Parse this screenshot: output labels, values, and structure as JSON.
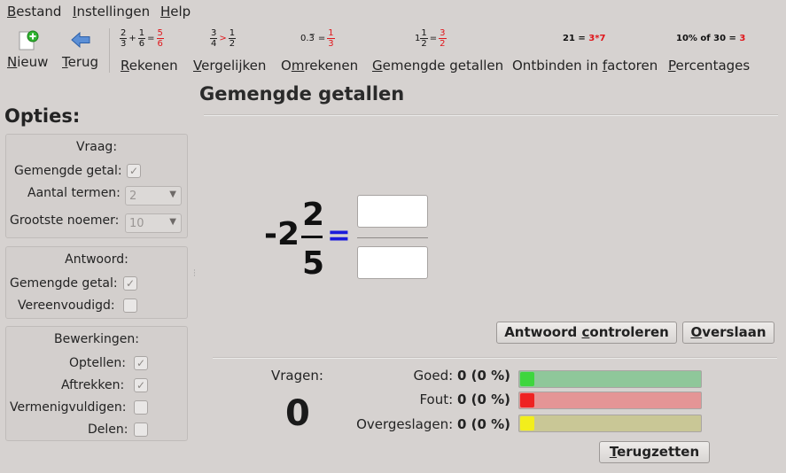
{
  "menu": {
    "items": [
      {
        "first": "B",
        "rest": "estand"
      },
      {
        "first": "I",
        "rest": "nstellingen"
      },
      {
        "first": "H",
        "rest": "elp"
      }
    ]
  },
  "toolbar": {
    "new": {
      "first": "N",
      "rest": "ieuw",
      "icon": "new-document-icon"
    },
    "back": {
      "first": "T",
      "rest": "erug",
      "icon": "arrow-left-icon"
    },
    "modes": [
      {
        "first": "R",
        "rest": "ekenen"
      },
      {
        "first": "V",
        "rest": "ergelijken"
      },
      {
        "pre": "O",
        "u": "m",
        "rest": "rekenen"
      },
      {
        "pre": "",
        "u": "G",
        "rest": "emengde getallen"
      },
      {
        "pre": "Ontbinden in ",
        "u": "f",
        "rest": "actoren"
      },
      {
        "pre": "",
        "u": "P",
        "rest": "ercentages"
      }
    ],
    "previews": {
      "rekenen": {
        "a_n": "2",
        "a_d": "3",
        "op1": "+",
        "b_n": "1",
        "b_d": "6",
        "eq": "=",
        "r_n": "5",
        "r_d": "6"
      },
      "vergelijken": {
        "a_n": "3",
        "a_d": "4",
        "op": ">",
        "b_n": "1",
        "b_d": "2"
      },
      "omrekenen": {
        "left": "0.3̅",
        "eq": "=",
        "r_n": "1",
        "r_d": "3"
      },
      "gemengd": {
        "whole": "1",
        "a_n": "1",
        "a_d": "2",
        "eq": "=",
        "r_n": "3",
        "r_d": "2"
      },
      "factoren": {
        "left": "21 =",
        "right": "3*7"
      },
      "percentages": {
        "left": "10% of 30 =",
        "right": "3"
      }
    }
  },
  "page_title": "Gemengde getallen",
  "sidebar": {
    "title": "Opties:",
    "vraag": {
      "title": "Vraag:",
      "gemengd_label": "Gemengde getal:",
      "gemengd_checked": "✓",
      "termen_label": "Aantal termen:",
      "termen_value": "2",
      "noemer_label": "Grootste noemer:",
      "noemer_value": "10"
    },
    "antwoord": {
      "title": "Antwoord:",
      "gemengd_label": "Gemengde getal:",
      "gemengd_checked": "✓",
      "vereenvoudigd_label": "Vereenvoudigd:",
      "vereenvoudigd_checked": ""
    },
    "bewerkingen": {
      "title": "Bewerkingen:",
      "items": [
        {
          "label": "Optellen:",
          "checked": "✓"
        },
        {
          "label": "Aftrekken:",
          "checked": "✓"
        },
        {
          "label": "Vermenigvuldigen:",
          "checked": ""
        },
        {
          "label": "Delen:",
          "checked": ""
        }
      ]
    }
  },
  "exercise": {
    "whole": "-2",
    "numerator": "2",
    "denominator": "5",
    "equals": "=",
    "answer_numerator": "",
    "answer_denominator": ""
  },
  "buttons": {
    "check": {
      "pre": "Antwoord ",
      "u": "c",
      "rest": "ontroleren"
    },
    "skip": {
      "pre": "",
      "u": "O",
      "rest": "verslaan"
    },
    "reset": {
      "pre": "",
      "u": "T",
      "rest": "erugzetten"
    }
  },
  "stats": {
    "questions_label": "Vragen:",
    "questions_count": "0",
    "rows": [
      {
        "label": "Goed:",
        "value": "0 (0 %)",
        "fraction": 0,
        "color": "#8fc79a",
        "marker": "#3ed63e"
      },
      {
        "label": "Fout:",
        "value": "0 (0 %)",
        "fraction": 0,
        "color": "#e49596",
        "marker": "#ee2222"
      },
      {
        "label": "Overgeslagen:",
        "value": "0 (0 %)",
        "fraction": 0,
        "color": "#c9c796",
        "marker": "#f2ee1c"
      }
    ]
  }
}
